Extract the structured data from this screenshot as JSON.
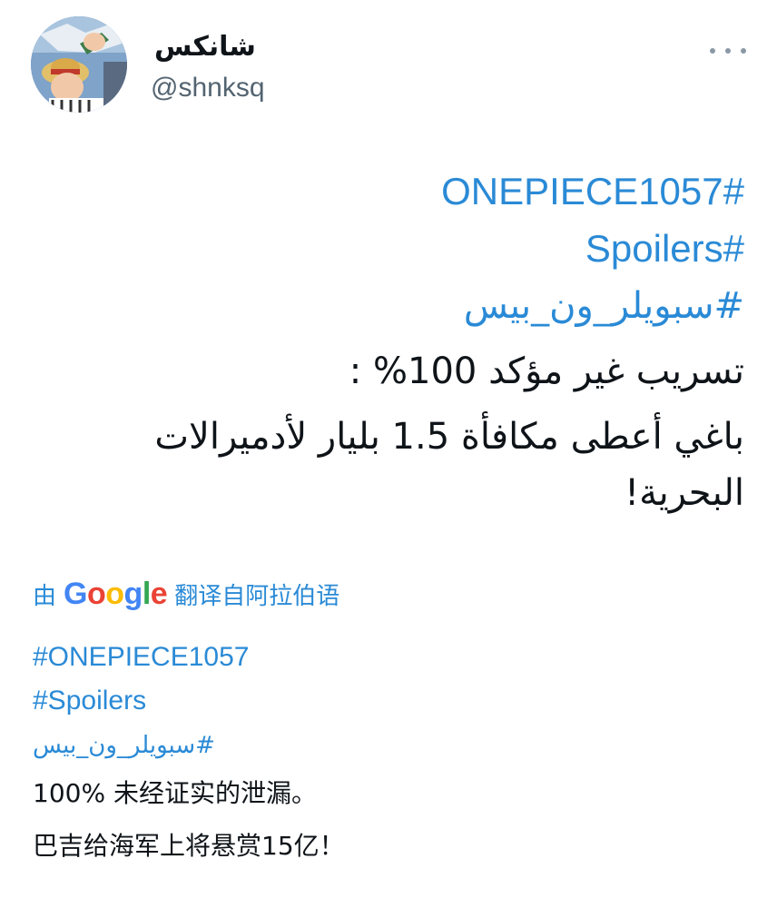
{
  "user": {
    "display_name": "شانكس",
    "handle": "@shnksq"
  },
  "tweet": {
    "hashtags": [
      "#ONEPIECE1057",
      "#Spoilers",
      "#سبويلر_ون_بيس"
    ],
    "line1": "تسريب غير مؤكد 100% :",
    "line2": "باغي أعطى مكافأة 1.5 بليار لأدميرالات",
    "line3": "البحرية!"
  },
  "translation": {
    "prefix": "由",
    "brand": "Google",
    "suffix": "翻译自阿拉伯语",
    "hashtags": [
      "#ONEPIECE1057",
      "#Spoilers",
      "#سبويلر_ون_بيس"
    ],
    "line1": "100% 未经证实的泄漏。",
    "line2": "巴吉给海军上将悬赏15亿！"
  },
  "colors": {
    "link": "#2a8ad6",
    "text": "#0f1419",
    "secondary": "#536471",
    "google_blue": "#4285F4",
    "google_red": "#EA4335",
    "google_yellow": "#FBBC05",
    "google_green": "#34A853"
  },
  "icons": {
    "more": "more-dots-icon",
    "avatar": "avatar-image"
  }
}
